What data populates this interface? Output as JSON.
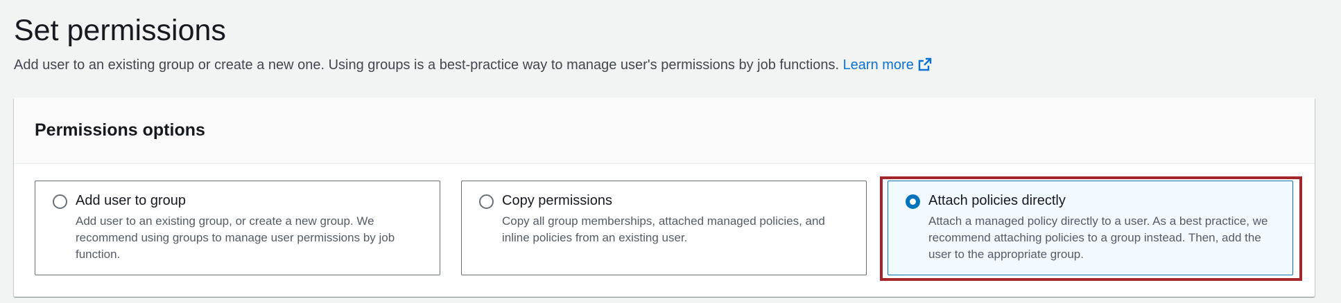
{
  "header": {
    "title": "Set permissions",
    "description": "Add user to an existing group or create a new one. Using groups is a best-practice way to manage user's permissions by job functions.",
    "learn_more": "Learn more",
    "learn_more_icon": "external-link-icon"
  },
  "permissions": {
    "title": "Permissions options",
    "options": [
      {
        "label": "Add user to group",
        "description": "Add user to an existing group, or create a new group. We recommend using groups to manage user permissions by job function.",
        "selected": false
      },
      {
        "label": "Copy permissions",
        "description": "Copy all group memberships, attached managed policies, and inline policies from an existing user.",
        "selected": false
      },
      {
        "label": "Attach policies directly",
        "description": "Attach a managed policy directly to a user. As a best practice, we recommend attaching policies to a group instead. Then, add the user to the appropriate group.",
        "selected": true
      }
    ]
  },
  "colors": {
    "link": "#0972d3",
    "selected_border": "#0073bb",
    "selected_background": "#f1faff",
    "highlight_border": "#a4252a"
  }
}
